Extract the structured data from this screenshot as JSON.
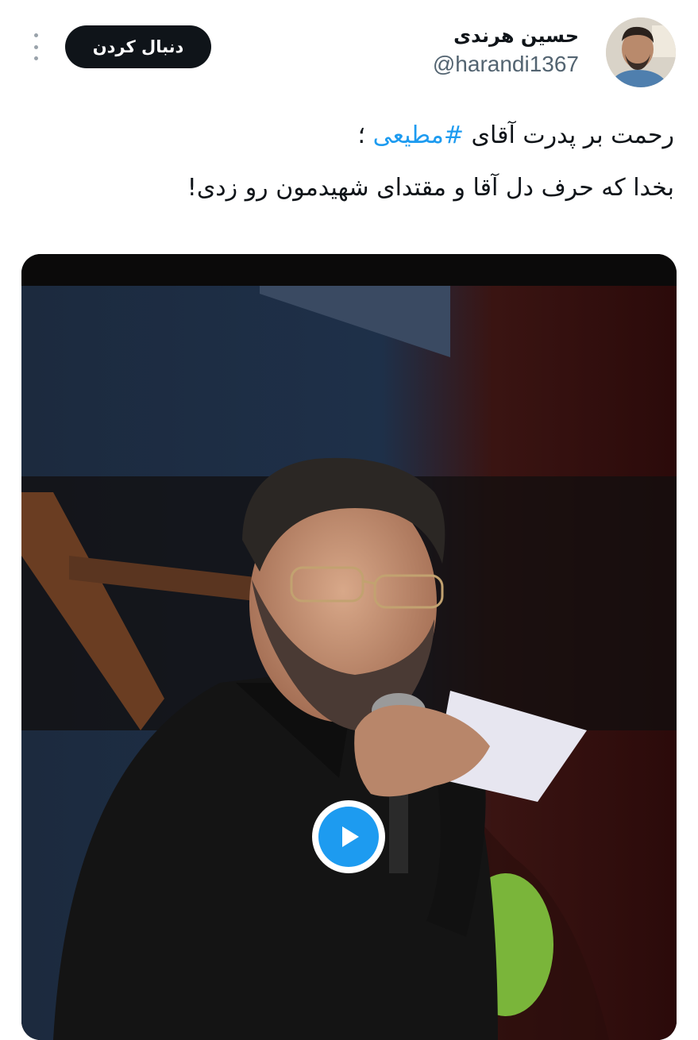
{
  "header": {
    "display_name": "حسین هرندی",
    "handle": "@harandi1367",
    "follow_label": "دنبال کردن"
  },
  "tweet": {
    "line1_prefix": "رحمت بر پدرت آقای ",
    "hashtag": "#مطیعی",
    "line1_suffix": " ؛",
    "line2": "بخدا که حرف دل آقا و مقتدای شهیدمون رو زدی!"
  },
  "media": {
    "type": "video",
    "play_icon": "play-icon"
  },
  "colors": {
    "accent": "#1d9bf0",
    "text": "#0f1419",
    "secondary_text": "#536471",
    "follow_button_bg": "#0f1419"
  }
}
